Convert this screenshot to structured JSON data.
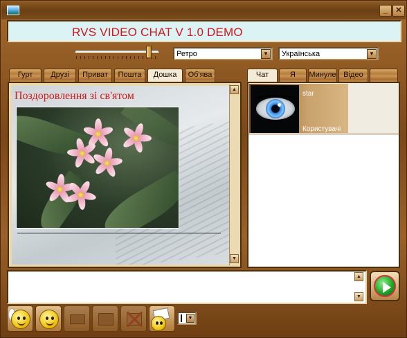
{
  "window": {
    "title": ""
  },
  "header": {
    "app_title": "RVS VIDEO CHAT V 1.0 DEMO"
  },
  "controls": {
    "volume_level": 0.9,
    "style_select": {
      "value": "Ретро"
    },
    "language_select": {
      "value": "Українська"
    }
  },
  "left_tabs": [
    {
      "label": "Гурт",
      "active": false
    },
    {
      "label": "Друзі",
      "active": false
    },
    {
      "label": "Приват",
      "active": false
    },
    {
      "label": "Пошта",
      "active": false
    },
    {
      "label": "Дошка",
      "active": true
    },
    {
      "label": "Об'ява",
      "active": false
    }
  ],
  "right_tabs": [
    {
      "label": "Чат",
      "active": true
    },
    {
      "label": "Я",
      "active": false
    },
    {
      "label": "Минуле",
      "active": false
    },
    {
      "label": "Відео",
      "active": false
    },
    {
      "label": "",
      "active": false
    }
  ],
  "board": {
    "heading": "Поздоровлення зі св'ятом"
  },
  "user": {
    "name": "star",
    "role": "Користувачі"
  },
  "message": {
    "value": ""
  },
  "icons": {
    "send": "play-circle-icon",
    "angel": "angel-smiley-icon",
    "smiley": "smiley-icon",
    "envelope": "envelope-icon",
    "box": "box-icon",
    "gift": "gift-icon",
    "block": "block-user-icon",
    "card": "greeting-card-icon"
  },
  "colors": {
    "title_red": "#d3151b",
    "board_heading": "#d01a1a",
    "send_green": "#1fa827"
  }
}
